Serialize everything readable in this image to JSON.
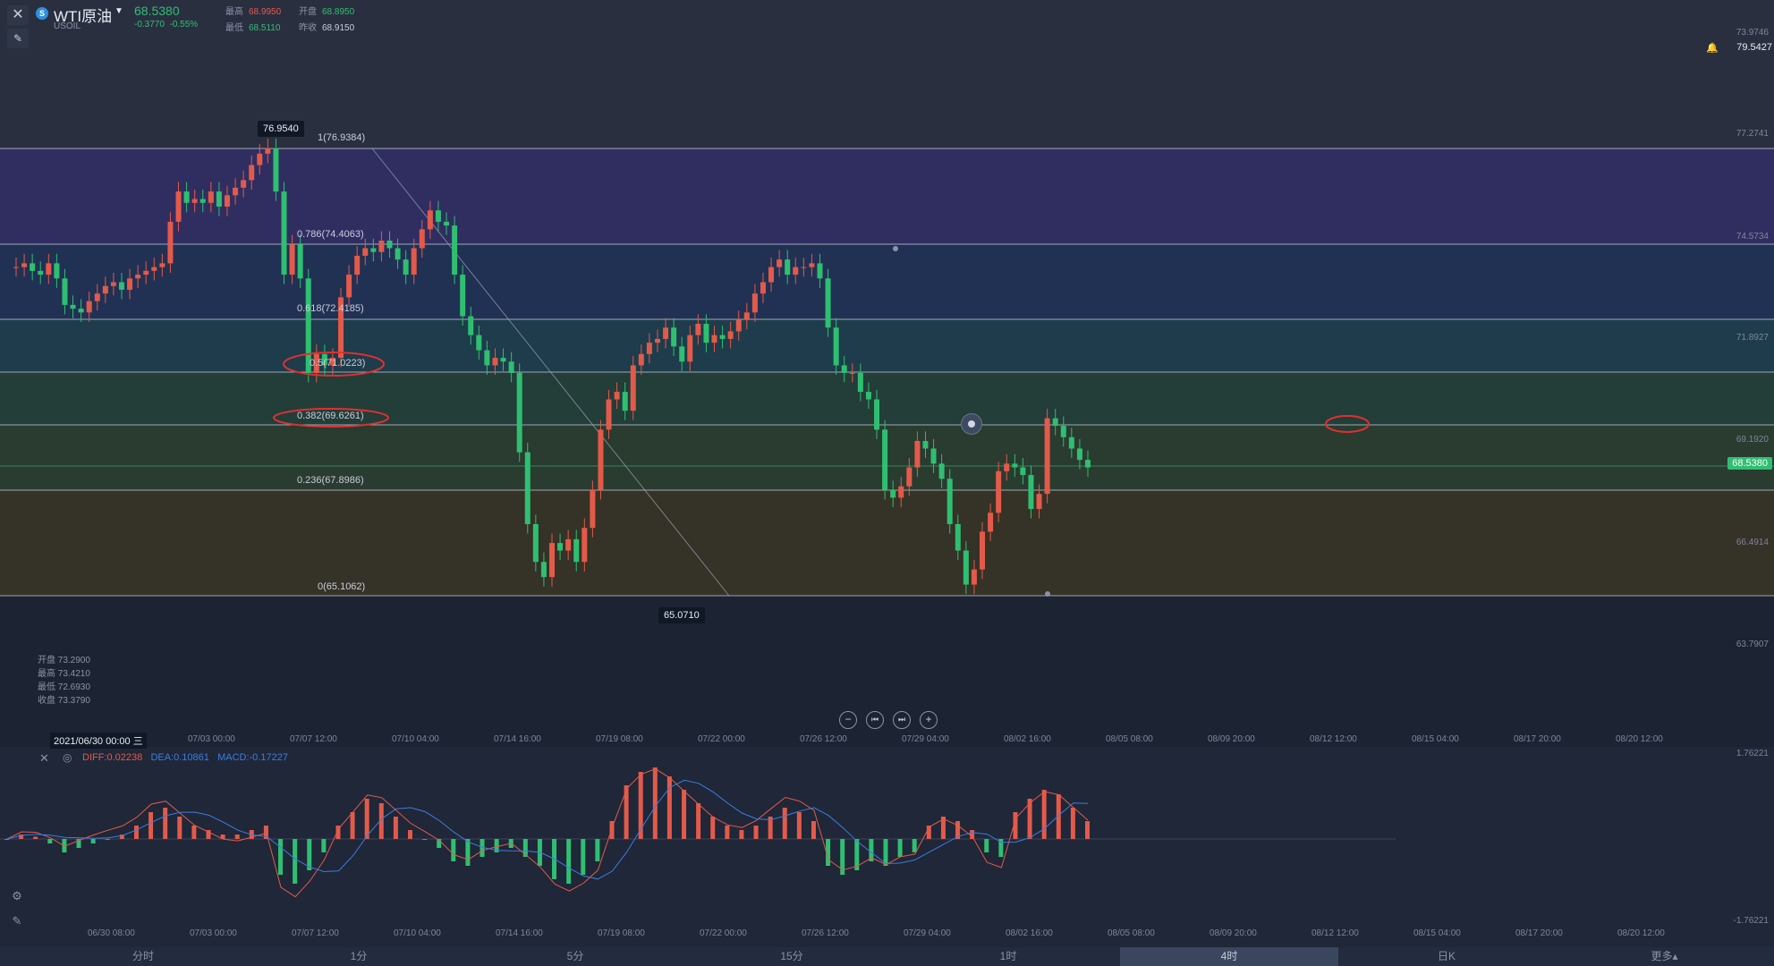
{
  "header": {
    "symbol_name": "WTI原油",
    "symbol_code": "USOIL",
    "last_price": "68.5380",
    "change": "-0.3770",
    "change_pct": "-0.55%",
    "high_label": "最高",
    "high": "68.9950",
    "open_label": "开盘",
    "open": "68.8950",
    "low_label": "最低",
    "low": "68.5110",
    "prev_label": "昨收",
    "prev": "68.9150"
  },
  "colors": {
    "up": "#e35a4a",
    "down": "#2fbf71",
    "diff": "#e35a4a",
    "dea": "#3c7de0",
    "fib_line": "#c8cedb"
  },
  "price_axis": {
    "ticks": [
      "73.9746",
      "77.2741",
      "74.5734",
      "71.8927",
      "69.1920",
      "66.4914",
      "63.7907"
    ],
    "current_price": "68.5380",
    "alert_price": "79.5427"
  },
  "fib_levels": [
    {
      "label": "1(76.9384)",
      "price": 76.9384
    },
    {
      "label": "0.786(74.4063)",
      "price": 74.4063
    },
    {
      "label": "0.618(72.4185)",
      "price": 72.4185
    },
    {
      "label": "0.5(71.0223)",
      "price": 71.0223
    },
    {
      "label": "0.382(69.6261)",
      "price": 69.6261
    },
    {
      "label": "0.236(67.8986)",
      "price": 67.8986
    },
    {
      "label": "0(65.1062)",
      "price": 65.1062
    }
  ],
  "extremes": {
    "high_label": "76.9540",
    "low_label": "65.0710"
  },
  "crosshair_ohlc": {
    "open_label": "开盘",
    "open": "73.2900",
    "high_label": "最高",
    "high": "73.4210",
    "low_label": "最低",
    "low": "72.6930",
    "close_label": "收盘",
    "close": "73.3790"
  },
  "time_axis": [
    "07/03 00:00",
    "07/07 12:00",
    "07/10 04:00",
    "07/14 16:00",
    "07/19 08:00",
    "07/22 00:00",
    "07/26 12:00",
    "07/29 04:00",
    "08/02 16:00",
    "08/05 08:00",
    "08/09 20:00",
    "08/12 12:00",
    "08/15 04:00",
    "08/17 20:00",
    "08/20 12:00"
  ],
  "crosshair_date": "2021/06/30 00:00 三",
  "macd": {
    "diff_label": "DIFF:",
    "diff": "0.02238",
    "dea_label": "DEA:",
    "dea": "0.10861",
    "macd_label": "MACD:",
    "macd": "-0.17227",
    "top_tick": "1.76221",
    "bottom_tick": "-1.76221"
  },
  "macd_time_axis": [
    "06/30 08:00",
    "07/03 00:00",
    "07/07 12:00",
    "07/10 04:00",
    "07/14 16:00",
    "07/19 08:00",
    "07/22 00:00",
    "07/26 12:00",
    "07/29 04:00",
    "08/02 16:00",
    "08/05 08:00",
    "08/09 20:00",
    "08/12 12:00",
    "08/15 04:00",
    "08/17 20:00",
    "08/20 12:00"
  ],
  "timeframes": [
    {
      "label": "分时",
      "active": false
    },
    {
      "label": "1分",
      "active": false
    },
    {
      "label": "5分",
      "active": false
    },
    {
      "label": "15分",
      "active": false
    },
    {
      "label": "1时",
      "active": false
    },
    {
      "label": "4时",
      "active": true
    },
    {
      "label": "日K",
      "active": false
    },
    {
      "label": "更多▴",
      "active": false
    }
  ],
  "icons": [
    "close-icon",
    "pencil-icon",
    "bell-icon",
    "zoom-out-icon",
    "step-back-icon",
    "step-forward-icon",
    "zoom-in-icon",
    "settings-icon",
    "indicator-icon",
    "draw-icon",
    "wave-icon"
  ]
}
